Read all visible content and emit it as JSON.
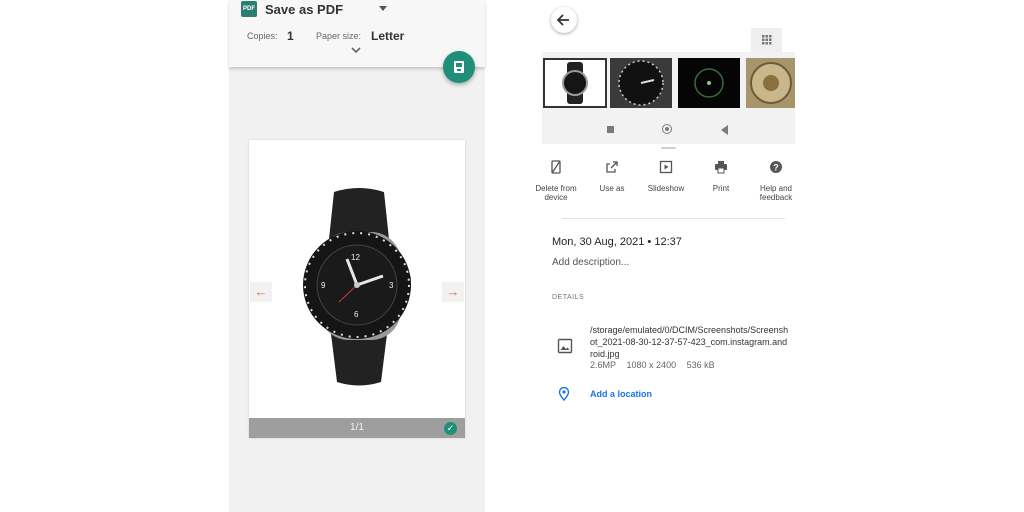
{
  "print_dialog": {
    "destination": "Save as PDF",
    "pdf_icon_text": "PDF",
    "copies_label": "Copies:",
    "copies_value": "1",
    "paper_size_label": "Paper size:",
    "paper_size_value": "Letter",
    "page_counter": "1/1"
  },
  "photo_details": {
    "actions": [
      {
        "label": "Delete from device",
        "icon": "trash-phone-icon"
      },
      {
        "label": "Use as",
        "icon": "open-external-icon"
      },
      {
        "label": "Slideshow",
        "icon": "slideshow-icon"
      },
      {
        "label": "Print",
        "icon": "printer-icon"
      },
      {
        "label": "Help and feedback",
        "icon": "help-icon"
      }
    ],
    "date": "Mon, 30 Aug, 2021",
    "time": "12:37",
    "add_description": "Add description...",
    "details_heading": "DETAILS",
    "file_path": "/storage/emulated/0/DCIM/Screenshots/Screenshot_2021-08-30-12-37-57-423_com.instagram.android.jpg",
    "megapixels": "2.6MP",
    "resolution": "1080 x 2400",
    "file_size": "536 kB",
    "add_location": "Add a location"
  },
  "colors": {
    "accent_teal": "#1f8f7a",
    "link_blue": "#1a73e8",
    "nav_arrow": "#e0713a"
  }
}
